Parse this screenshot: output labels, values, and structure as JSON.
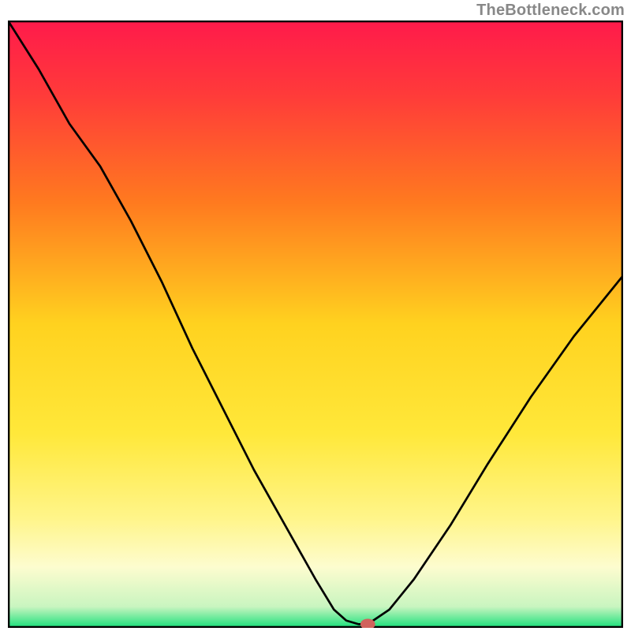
{
  "watermark": "TheBottleneck.com",
  "chart_data": {
    "type": "line",
    "title": "",
    "xlabel": "",
    "ylabel": "",
    "xlim": [
      0,
      100
    ],
    "ylim": [
      0,
      100
    ],
    "background": {
      "type": "vertical-gradient",
      "stops": [
        {
          "offset": 0.0,
          "color": "#ff1a4b"
        },
        {
          "offset": 0.12,
          "color": "#ff3a3a"
        },
        {
          "offset": 0.3,
          "color": "#ff7a1f"
        },
        {
          "offset": 0.5,
          "color": "#ffd21f"
        },
        {
          "offset": 0.68,
          "color": "#ffe83a"
        },
        {
          "offset": 0.82,
          "color": "#fff58a"
        },
        {
          "offset": 0.9,
          "color": "#fdfccf"
        },
        {
          "offset": 0.965,
          "color": "#c9f5c0"
        },
        {
          "offset": 1.0,
          "color": "#18e07a"
        }
      ]
    },
    "border_color": "#000000",
    "series": [
      {
        "name": "bottleneck-curve",
        "color": "#000000",
        "x": [
          0,
          5,
          10,
          15,
          20,
          25,
          30,
          35,
          40,
          45,
          50,
          53,
          55,
          57,
          58.5,
          62,
          66,
          72,
          78,
          85,
          92,
          100
        ],
        "y": [
          100,
          92,
          83,
          76,
          67,
          57,
          46,
          36,
          26,
          17,
          8,
          3,
          1.2,
          0.6,
          0.6,
          3,
          8,
          17,
          27,
          38,
          48,
          58
        ]
      }
    ],
    "marker": {
      "name": "minimum-marker",
      "x": 58.5,
      "y": 0.6,
      "rx": 1.2,
      "ry": 0.9,
      "color": "#d1625c"
    }
  }
}
